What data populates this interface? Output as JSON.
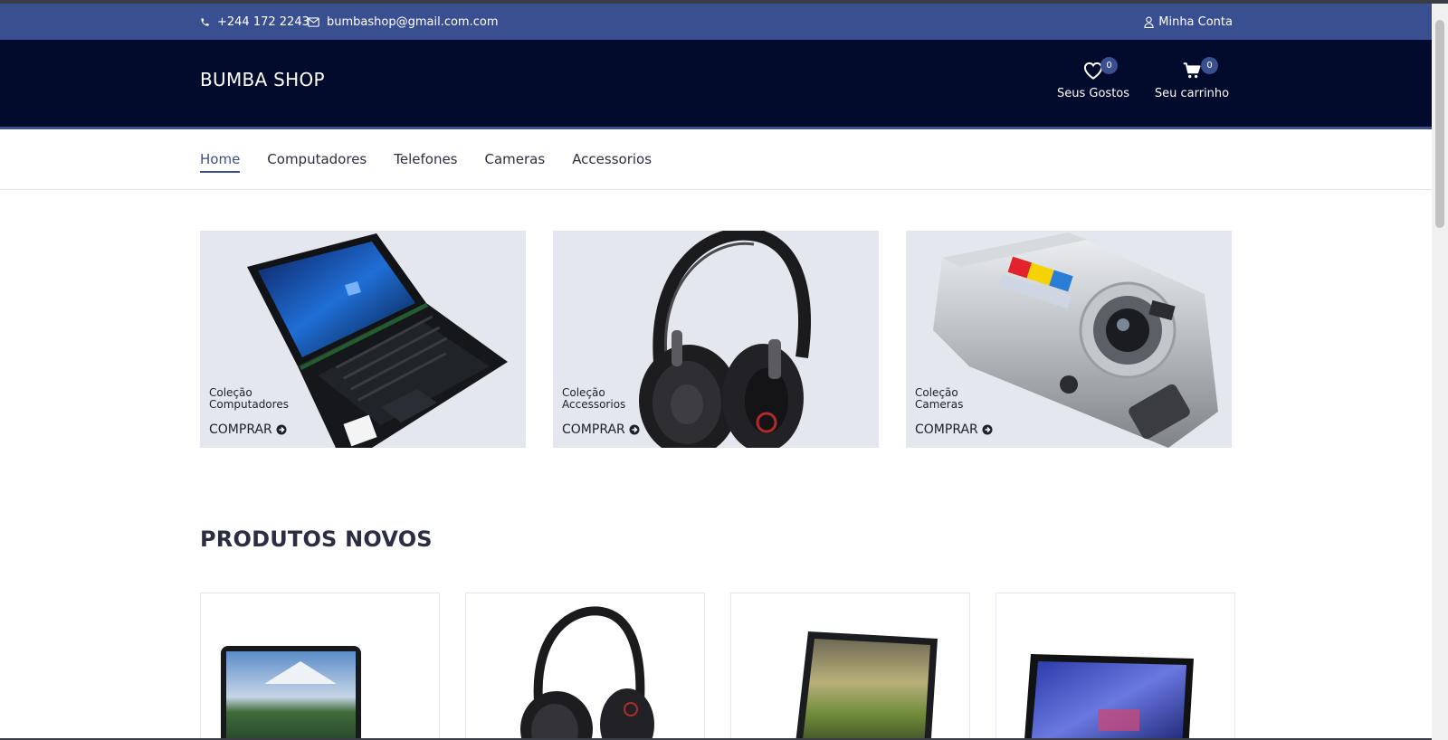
{
  "topbar": {
    "phone": "+244 172 2243",
    "email": "bumbashop@gmail.com.com",
    "account": "Minha Conta"
  },
  "header": {
    "logo": "BUMBA SHOP",
    "wishlist_label": "Seus Gostos",
    "wishlist_count": "0",
    "cart_label": "Seu carrinho",
    "cart_count": "0"
  },
  "nav": {
    "items": [
      {
        "label": "Home"
      },
      {
        "label": "Computadores"
      },
      {
        "label": "Telefones"
      },
      {
        "label": "Cameras"
      },
      {
        "label": "Accessorios"
      }
    ]
  },
  "collections": [
    {
      "line1": "Coleção",
      "line2": "Computadores",
      "cta": "COMPRAR"
    },
    {
      "line1": "Coleção",
      "line2": "Accessorios",
      "cta": "COMPRAR"
    },
    {
      "line1": "Coleção",
      "line2": "Cameras",
      "cta": "COMPRAR"
    }
  ],
  "section": {
    "title": "PRODUTOS NOVOS"
  },
  "colors": {
    "accent": "#3a4f8f",
    "header_bg": "#020b2b",
    "tile_bg": "#e4e7ed"
  }
}
